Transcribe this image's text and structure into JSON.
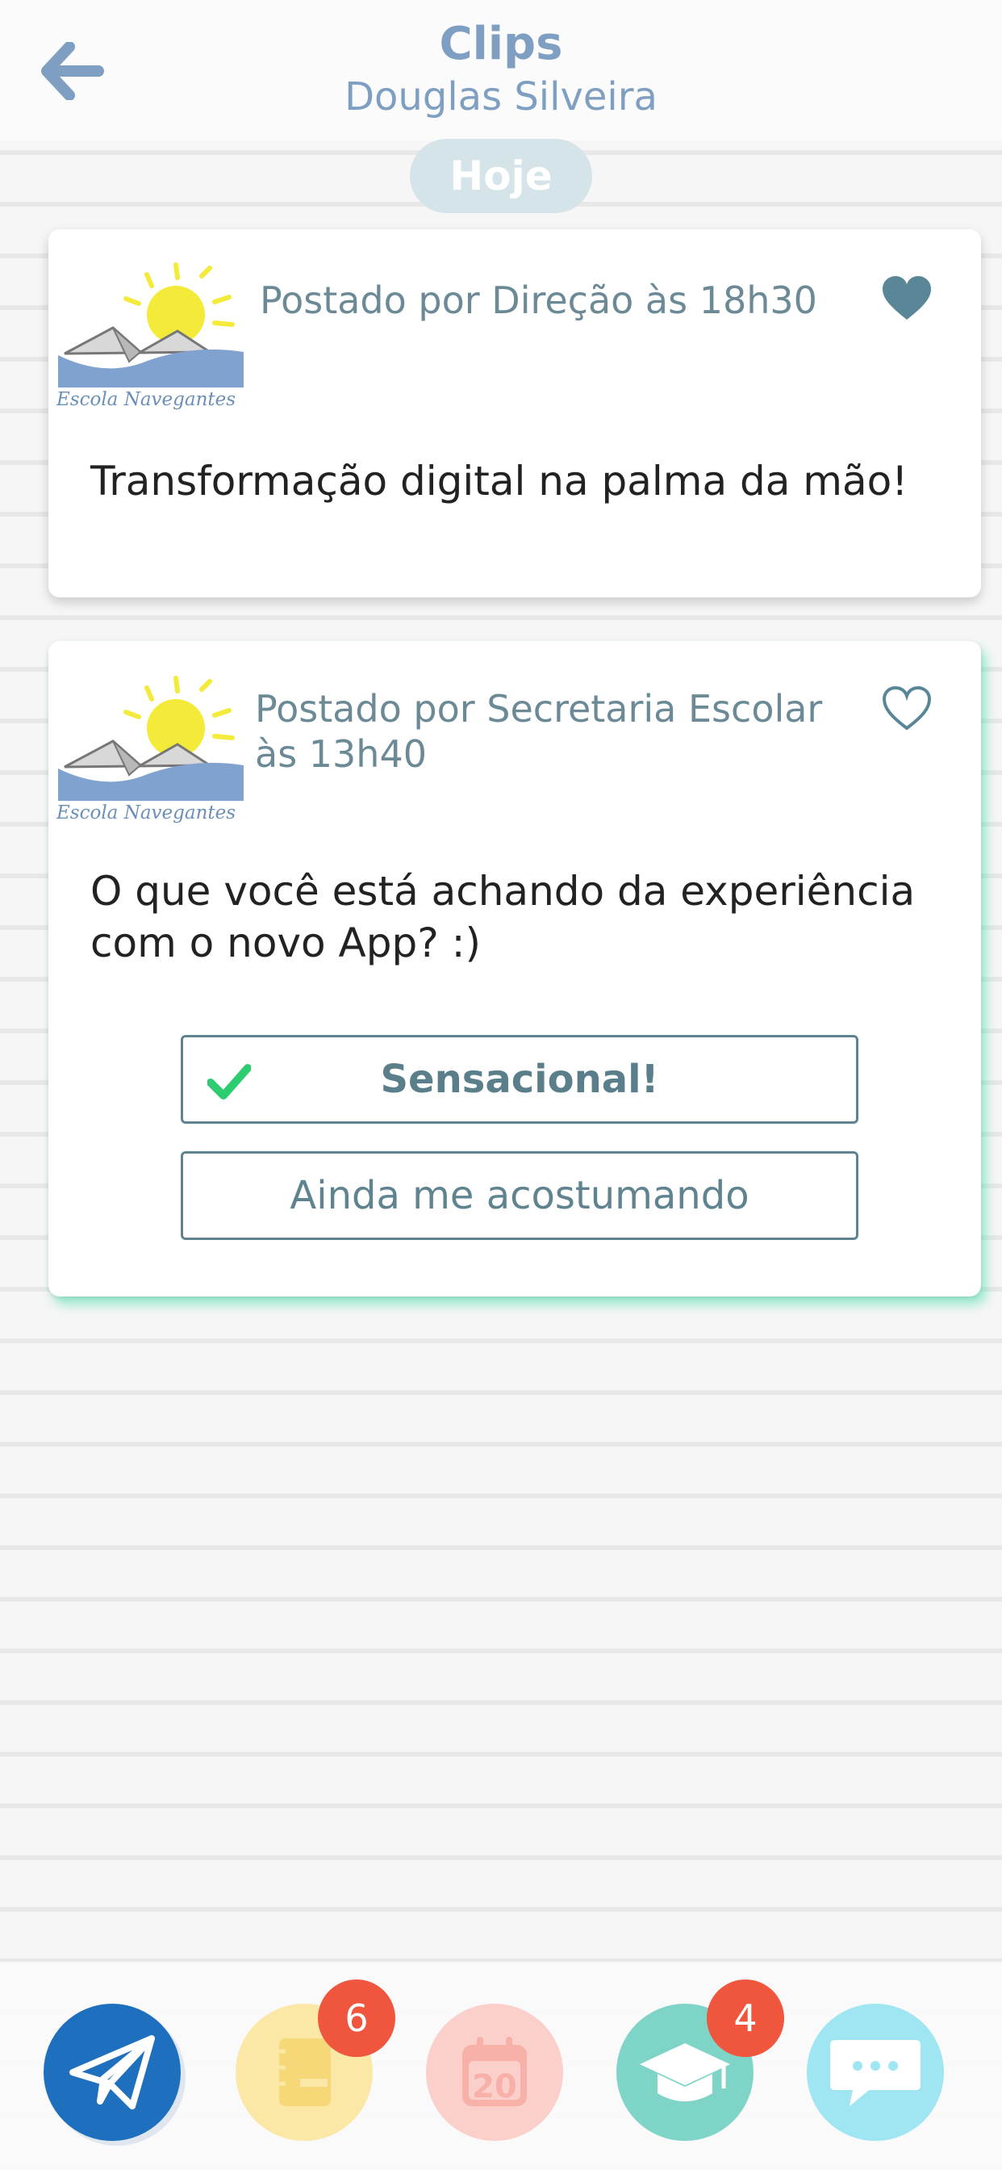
{
  "header": {
    "title": "Clips",
    "subtitle": "Douglas Silveira"
  },
  "date_label": "Hoje",
  "school_logo_caption": "Escola Navegantes",
  "posts": [
    {
      "meta": "Postado por Direção às 18h30",
      "body": "Transformação digital na palma da mão!",
      "liked": true
    },
    {
      "meta_line1": "Postado por Secretaria Escolar",
      "meta_line2": "às 13h40",
      "body_line1": "O que você está achando da experiência",
      "body_line2": "com o novo App? :)",
      "liked": false,
      "options": [
        {
          "label": "Sensacional!",
          "selected": true
        },
        {
          "label": "Ainda me acostumando",
          "selected": false
        }
      ]
    }
  ],
  "bottom_nav": [
    {
      "icon": "paper-plane-icon",
      "color": "#1f6fbf"
    },
    {
      "icon": "notebook-icon",
      "color": "#fbe7a6",
      "badge": "6"
    },
    {
      "icon": "calendar-icon",
      "color": "#fbd0cb",
      "day": "20"
    },
    {
      "icon": "graduation-cap-icon",
      "color": "#7fd4c8",
      "badge": "4"
    },
    {
      "icon": "chat-bubble-icon",
      "color": "#9fe6f2"
    }
  ],
  "colors": {
    "header_text": "#7f9fc2",
    "meta_text": "#6b8a96",
    "accent_green": "#2ecc71",
    "badge_red": "#f0553d"
  }
}
